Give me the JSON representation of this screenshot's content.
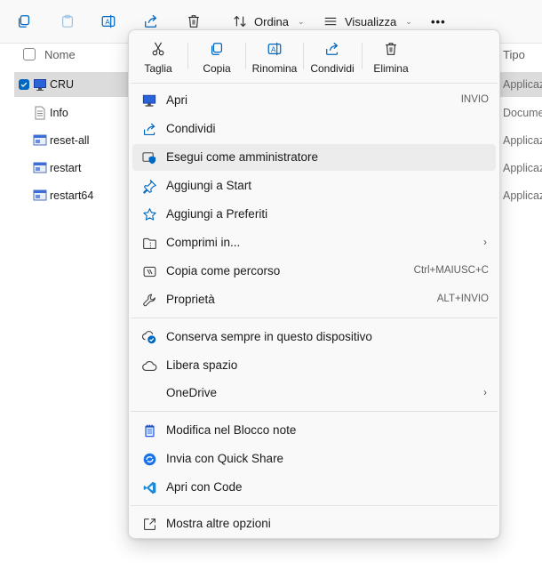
{
  "toolbar": {
    "sort_label": "Ordina",
    "view_label": "Visualizza",
    "more_label": "•••"
  },
  "list": {
    "header_name": "Nome",
    "header_type": "Tipo",
    "rows": [
      {
        "name": "CRU",
        "type": "Applicaz",
        "selected": true,
        "icon": "app-icon"
      },
      {
        "name": "Info",
        "type": "Docume",
        "selected": false,
        "icon": "text-file-icon"
      },
      {
        "name": "reset-all",
        "type": "Applicaz",
        "selected": false,
        "icon": "app-icon"
      },
      {
        "name": "restart",
        "type": "Applicaz",
        "selected": false,
        "icon": "app-icon"
      },
      {
        "name": "restart64",
        "type": "Applicaz",
        "selected": false,
        "icon": "app-icon"
      }
    ]
  },
  "menu": {
    "quick_actions": [
      {
        "label": "Taglia",
        "icon": "scissors-icon"
      },
      {
        "label": "Copia",
        "icon": "copy-icon"
      },
      {
        "label": "Rinomina",
        "icon": "rename-icon"
      },
      {
        "label": "Condividi",
        "icon": "share-icon"
      },
      {
        "label": "Elimina",
        "icon": "trash-icon"
      }
    ],
    "group1": [
      {
        "label": "Apri",
        "shortcut": "INVIO",
        "icon": "monitor-app-icon"
      },
      {
        "label": "Condividi",
        "shortcut": "",
        "icon": "share-icon"
      },
      {
        "label": "Esegui come amministratore",
        "shortcut": "",
        "icon": "admin-shield-icon"
      },
      {
        "label": "Aggiungi a Start",
        "shortcut": "",
        "icon": "pin-icon"
      },
      {
        "label": "Aggiungi a Preferiti",
        "shortcut": "",
        "icon": "star-icon"
      },
      {
        "label": "Comprimi in...",
        "shortcut": "",
        "icon": "zip-folder-icon"
      },
      {
        "label": "Copia come percorso",
        "shortcut": "Ctrl+MAIUSC+C",
        "icon": "copy-path-icon"
      },
      {
        "label": "Proprietà",
        "shortcut": "ALT+INVIO",
        "icon": "wrench-icon"
      }
    ],
    "group2": [
      {
        "label": "Conserva sempre in questo dispositivo",
        "icon": "cloud-keep-icon"
      },
      {
        "label": "Libera spazio",
        "icon": "cloud-icon"
      },
      {
        "label": "OneDrive",
        "icon": ""
      }
    ],
    "group3": [
      {
        "label": "Modifica nel Blocco note",
        "icon": "notepad-icon"
      },
      {
        "label": "Invia con Quick Share",
        "icon": "quick-share-icon"
      },
      {
        "label": "Apri con Code",
        "icon": "vscode-icon"
      }
    ],
    "group4": [
      {
        "label": "Mostra altre opzioni",
        "icon": "open-external-icon"
      }
    ],
    "submenu_arrow": "›"
  },
  "colors": {
    "accent": "#0067c0",
    "selection_row": "#dcdcdc",
    "menu_bg": "#f9f9f9",
    "hover_bg": "#ececec"
  }
}
